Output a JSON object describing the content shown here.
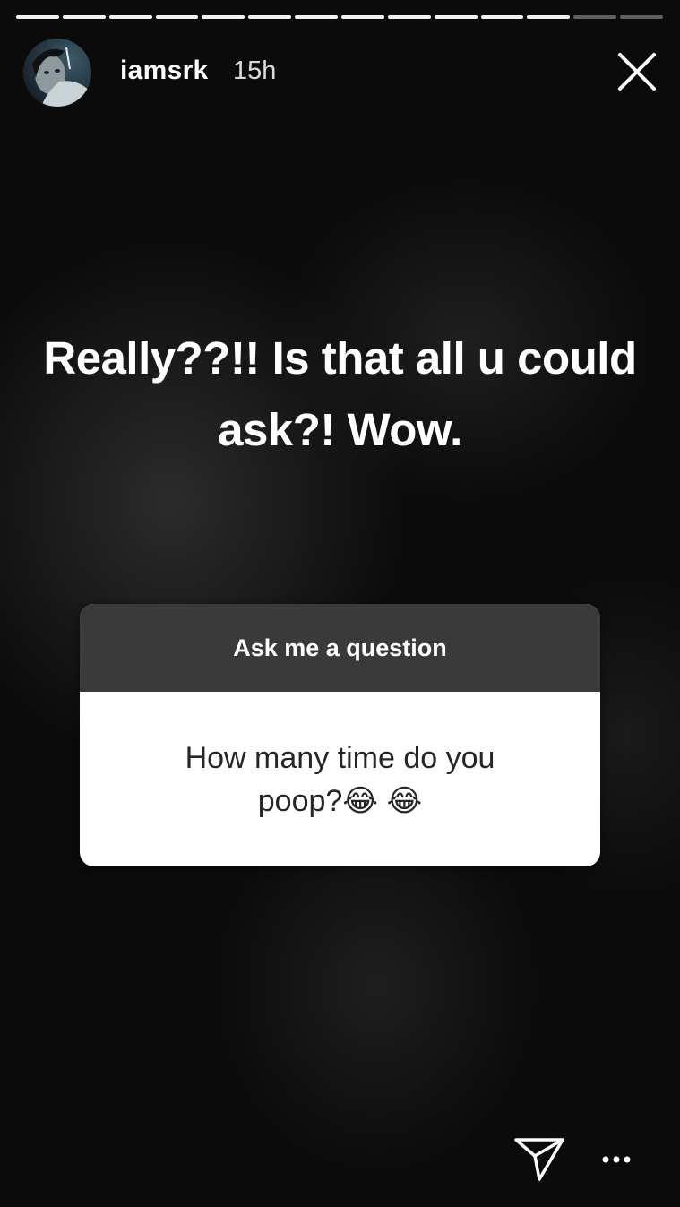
{
  "story": {
    "progress": {
      "segments": 14,
      "completed": 12
    },
    "author": {
      "username": "iamsrk",
      "time_ago": "15h",
      "avatar_icon": "profile-avatar"
    },
    "caption": "Really??!! Is that all u could ask?! Wow.",
    "question_sticker": {
      "title": "Ask me a question",
      "question": "How many time do you poop?😂 😂",
      "header_color": "#3a3a3a",
      "body_color": "#ffffff"
    },
    "controls": {
      "close_icon": "close-icon",
      "share_icon": "send-direct-icon",
      "more_icon": "more-options-icon"
    }
  }
}
